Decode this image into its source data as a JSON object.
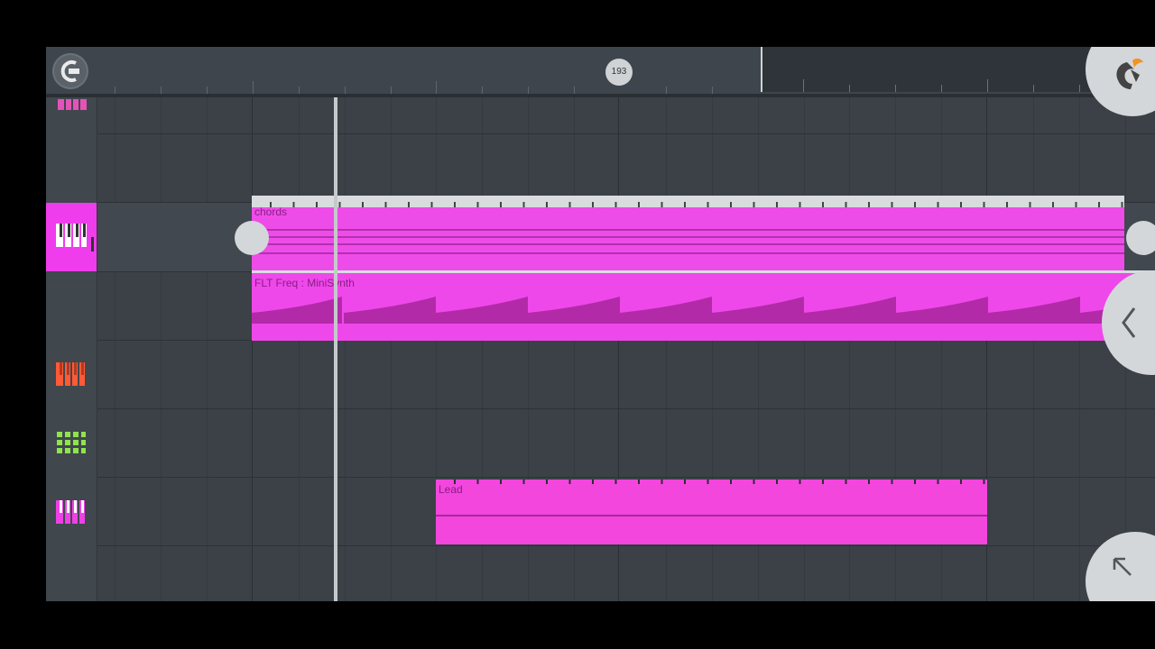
{
  "playlist": {
    "playhead_bar": "193",
    "clips": [
      {
        "name": "chords",
        "type": "pattern"
      },
      {
        "name": "FLT Freq : MiniSynth",
        "type": "automation"
      },
      {
        "name": "Lead",
        "type": "pattern"
      }
    ],
    "tracks": [
      {
        "icon": "piano-icon",
        "color": "#e552b8"
      },
      {
        "icon": "piano-icon",
        "color": "#ffffff"
      },
      {
        "icon": "piano-icon",
        "color": "#ff5a35"
      },
      {
        "icon": "drum-pads-icon",
        "color": "#8fe44a"
      },
      {
        "icon": "piano-icon",
        "color": "#ee40e6"
      }
    ]
  },
  "colors": {
    "accent": "#ef3cec",
    "background": "#3b4147"
  },
  "icons": [
    "snap-magnet-icon",
    "fl-logo-icon",
    "back-arrow-icon",
    "expand-arrow-icon"
  ]
}
